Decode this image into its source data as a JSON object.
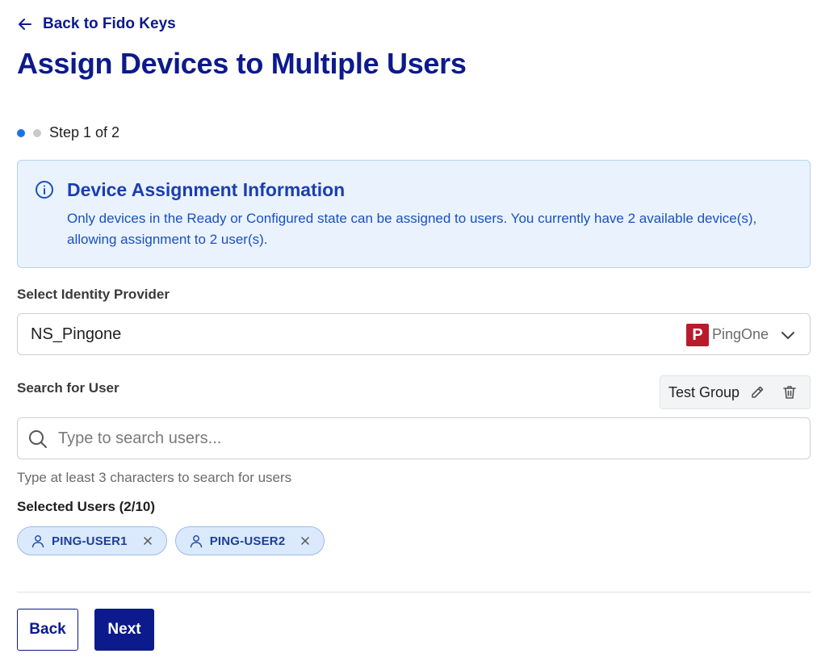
{
  "header": {
    "back_label": "Back to Fido Keys",
    "title": "Assign Devices to Multiple Users"
  },
  "stepper": {
    "text": "Step 1 of 2",
    "current": 1,
    "total": 2
  },
  "info": {
    "title": "Device Assignment Information",
    "text": "Only devices in the Ready or Configured state can be assigned to users. You currently have 2 available device(s), allowing assignment to 2 user(s)."
  },
  "identity_provider": {
    "label": "Select Identity Provider",
    "value": "NS_Pingone",
    "provider_logo_letter": "P",
    "provider_name": "PingOne"
  },
  "search": {
    "label": "Search for User",
    "placeholder": "Type to search users...",
    "value": "",
    "hint": "Type at least 3 characters to search for users"
  },
  "group": {
    "name": "Test Group"
  },
  "selected_users": {
    "label": "Selected Users (2/10)",
    "users": [
      {
        "name": "PING-USER1"
      },
      {
        "name": "PING-USER2"
      }
    ]
  },
  "actions": {
    "back_label": "Back",
    "next_label": "Next"
  },
  "colors": {
    "primary": "#0c1a8c",
    "info_background": "#eaf3fd",
    "info_text": "#1b4fc0",
    "chip_background": "#dbe9fc",
    "provider_logo": "#b81c2c",
    "step_active": "#1a73e8",
    "step_inactive": "#c9c9c9"
  },
  "icons": {
    "back": "arrow-left-icon",
    "info": "info-circle-icon",
    "dropdown": "chevron-down-icon",
    "edit": "pencil-icon",
    "delete": "trash-icon",
    "search": "search-icon",
    "user": "user-icon",
    "remove": "close-icon"
  }
}
